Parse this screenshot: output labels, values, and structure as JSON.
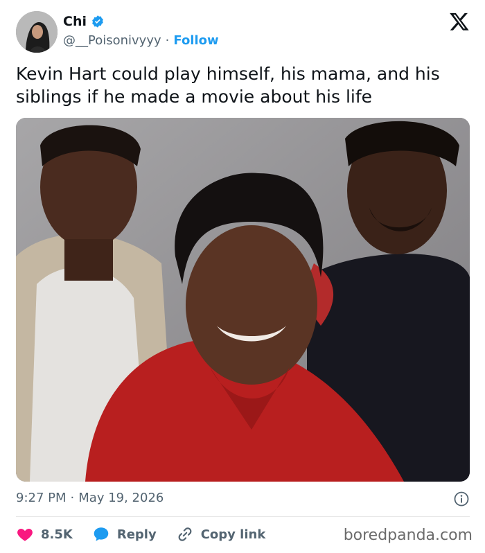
{
  "user": {
    "name": "Chi",
    "handle": "@__Poisonivyyy",
    "dot": "·",
    "follow_label": "Follow",
    "verified_icon": "verified-badge-icon"
  },
  "tweet": {
    "text": "Kevin Hart could play himself, his mama, and his siblings if he made a movie about his life"
  },
  "meta": {
    "time": "9:27 PM",
    "separator": "·",
    "date": "May 19, 2026"
  },
  "actions": {
    "likes_count": "8.5K",
    "reply_label": "Reply",
    "copy_label": "Copy link"
  },
  "watermark": "boredpanda.com",
  "colors": {
    "accent": "#1d9bf0",
    "like": "#f91880",
    "text_secondary": "#536471"
  }
}
